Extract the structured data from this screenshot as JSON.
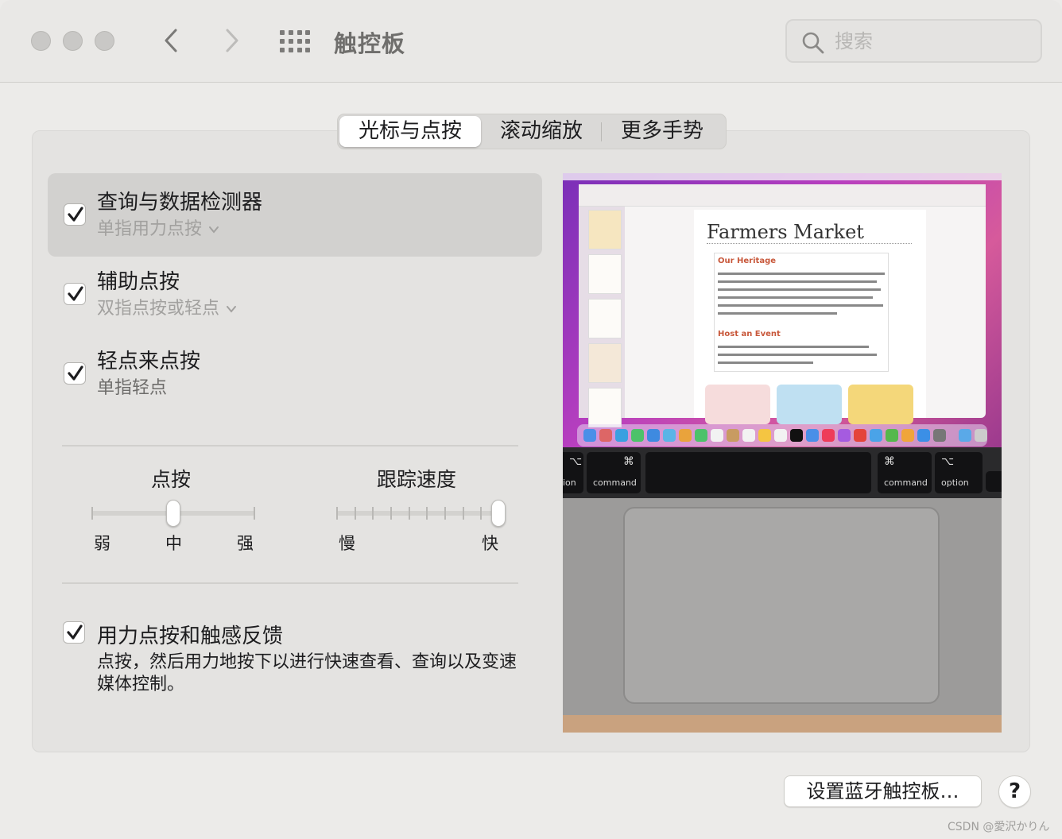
{
  "window": {
    "title": "触控板",
    "search_placeholder": "搜索"
  },
  "tabs": [
    {
      "label": "光标与点按",
      "active": true
    },
    {
      "label": "滚动缩放",
      "active": false
    },
    {
      "label": "更多手势",
      "active": false
    }
  ],
  "options": [
    {
      "title": "查询与数据检测器",
      "subtitle": "单指用力点按",
      "checked": true,
      "has_dropdown": true
    },
    {
      "title": "辅助点按",
      "subtitle": "双指点按或轻点",
      "checked": true,
      "has_dropdown": true
    },
    {
      "title": "轻点来点按",
      "subtitle": "单指轻点",
      "checked": true,
      "has_dropdown": false
    }
  ],
  "click_slider": {
    "label": "点按",
    "ticks": [
      "弱",
      "中",
      "强"
    ],
    "value_label": "中"
  },
  "tracking_slider": {
    "label": "跟踪速度",
    "min_label": "慢",
    "max_label": "快",
    "value_fraction": 1.0
  },
  "force_click": {
    "title": "用力点按和触感反馈",
    "checked": true,
    "description": "点按，然后用力地按下以进行快速查看、查询以及变速媒体控制。"
  },
  "preview": {
    "document_title": "Farmers Market",
    "section1": "Our Heritage",
    "section2": "Host an Event",
    "key_labels": [
      "ion",
      "command",
      "command",
      "option"
    ]
  },
  "buttons": {
    "bluetooth": "设置蓝牙触控板…",
    "help": "?"
  },
  "watermark": "CSDN @愛沢かりん",
  "colors": {
    "window_bg": "#ecebe9",
    "selected_row": "#d2d1cf",
    "accent_check": "#1d1d1f"
  }
}
